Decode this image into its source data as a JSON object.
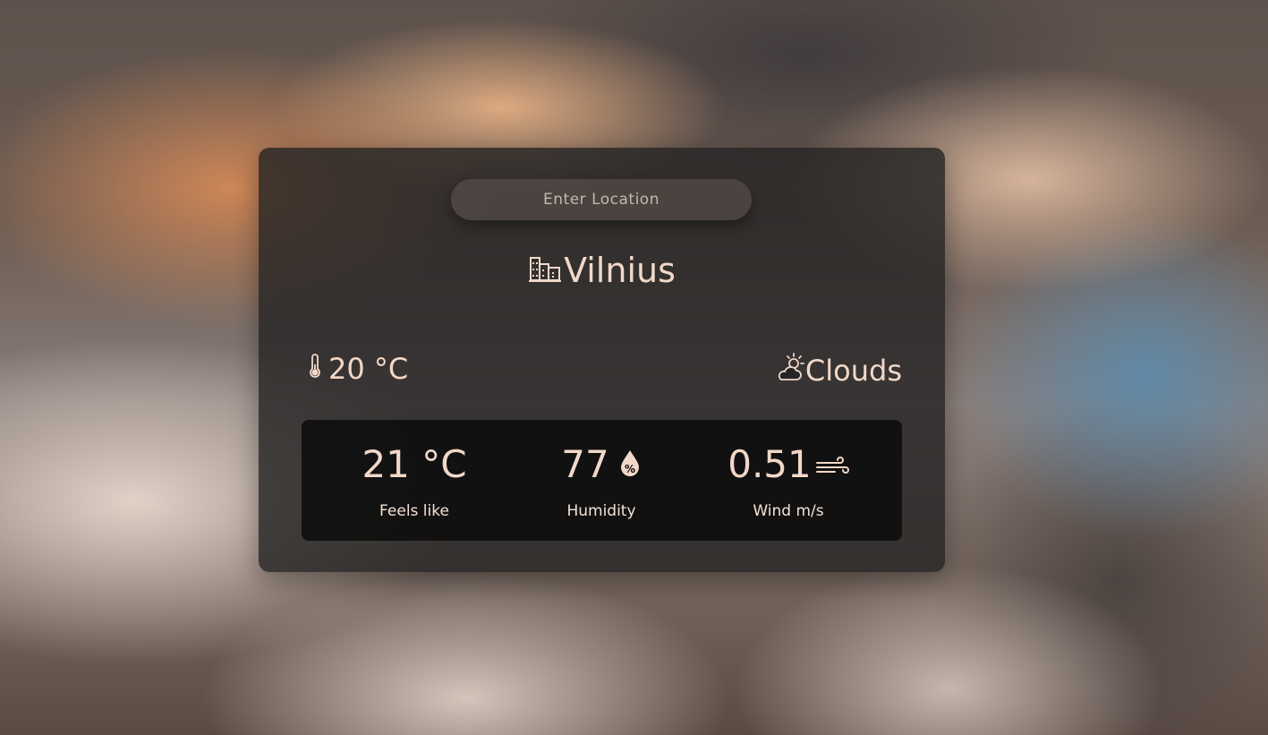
{
  "search": {
    "placeholder": "Enter Location",
    "value": ""
  },
  "location": {
    "city": "Vilnius",
    "icon": "city-buildings-icon"
  },
  "current": {
    "temperature": "20 °C",
    "temperature_icon": "thermometer-icon",
    "condition": "Clouds",
    "condition_icon": "partly-cloudy-icon"
  },
  "details": [
    {
      "value": "21 °C",
      "label": "Feels like",
      "icon": ""
    },
    {
      "value": "77",
      "label": "Humidity",
      "icon": "humidity-drop-percent-icon"
    },
    {
      "value": "0.51",
      "label": "Wind m/s",
      "icon": "wind-icon"
    }
  ],
  "colors": {
    "text": "#f1d8c8",
    "card": "#262424",
    "stats_panel": "#080808"
  }
}
